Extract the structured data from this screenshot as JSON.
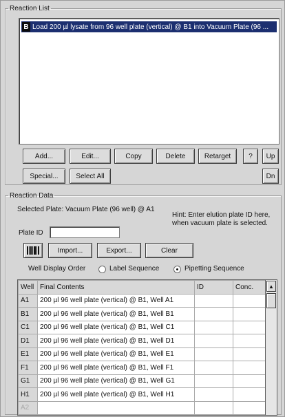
{
  "reaction_list": {
    "label": "Reaction List",
    "items": [
      {
        "icon": "B",
        "text": "Load 200 µl lysate from 96 well plate (vertical) @ B1 into Vacuum Plate (96 ..."
      }
    ],
    "buttons": {
      "add": "Add...",
      "edit": "Edit...",
      "copy": "Copy",
      "delete": "Delete",
      "retarget": "Retarget",
      "help": "?",
      "up": "Up",
      "special": "Special...",
      "select_all": "Select All",
      "down": "Dn"
    }
  },
  "reaction_data": {
    "label": "Reaction Data",
    "selected_plate": "Selected Plate: Vacuum Plate (96 well) @ A1",
    "hint": "Hint: Enter elution plate ID here, when vacuum plate is selected.",
    "plate_id_label": "Plate ID",
    "plate_id_value": "",
    "buttons": {
      "import": "Import...",
      "export": "Export...",
      "clear": "Clear"
    },
    "well_display_order": {
      "label": "Well Display Order",
      "options": [
        "Label Sequence",
        "Pipetting Sequence"
      ],
      "selected": "Pipetting Sequence"
    },
    "table": {
      "columns": [
        "Well",
        "Final Contents",
        "ID",
        "Conc."
      ],
      "rows": [
        {
          "well": "A1",
          "contents": "200 µl 96 well plate (vertical) @ B1, Well A1",
          "id": "",
          "conc": ""
        },
        {
          "well": "B1",
          "contents": "200 µl 96 well plate (vertical) @ B1, Well B1",
          "id": "",
          "conc": ""
        },
        {
          "well": "C1",
          "contents": "200 µl 96 well plate (vertical) @ B1, Well C1",
          "id": "",
          "conc": ""
        },
        {
          "well": "D1",
          "contents": "200 µl 96 well plate (vertical) @ B1, Well D1",
          "id": "",
          "conc": ""
        },
        {
          "well": "E1",
          "contents": "200 µl 96 well plate (vertical) @ B1, Well E1",
          "id": "",
          "conc": ""
        },
        {
          "well": "F1",
          "contents": "200 µl 96 well plate (vertical) @ B1, Well F1",
          "id": "",
          "conc": ""
        },
        {
          "well": "G1",
          "contents": "200 µl 96 well plate (vertical) @ B1, Well G1",
          "id": "",
          "conc": ""
        },
        {
          "well": "H1",
          "contents": "200 µl 96 well plate (vertical) @ B1, Well H1",
          "id": "",
          "conc": ""
        },
        {
          "well": "A2",
          "contents": "",
          "id": "",
          "conc": ""
        }
      ]
    }
  },
  "icons": {
    "barcode": "barcode-icon",
    "scroll_up": "scroll-up-arrow-icon",
    "radio_label_sequence": "radio-icon",
    "radio_pipetting_sequence": "radio-selected-icon"
  }
}
